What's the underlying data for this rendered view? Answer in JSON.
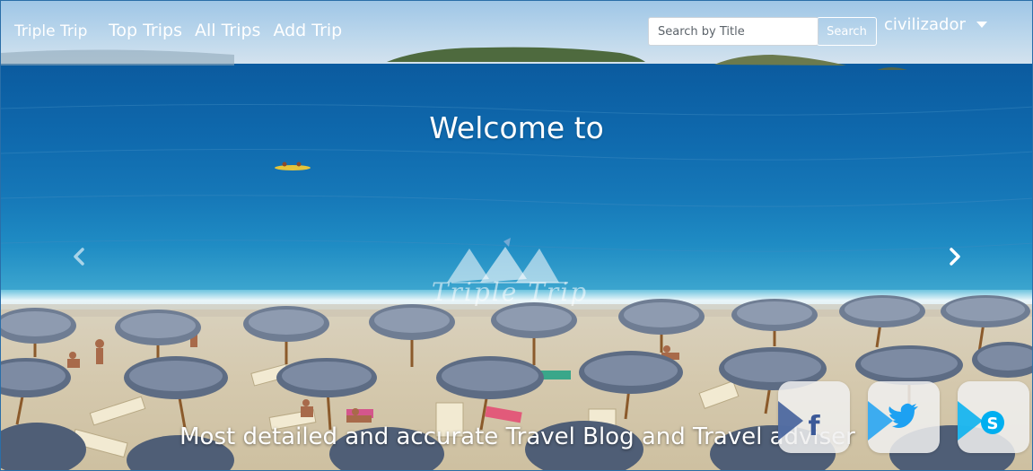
{
  "navbar": {
    "brand": "Triple Trip",
    "links": [
      "Top Trips",
      "All Trips",
      "Add Trip"
    ],
    "search": {
      "placeholder": "Search by Title",
      "value": "",
      "button_label": "Search"
    },
    "user": {
      "name": "civilizador"
    }
  },
  "carousel": {
    "title": "Welcome to",
    "logo_text": "Triple Trip",
    "caption": "Most detailed and accurate Travel Blog and Travel adviser",
    "controls": {
      "prev_icon": "chevron-left-icon",
      "next_icon": "chevron-right-icon"
    }
  },
  "social": {
    "items": [
      {
        "name": "facebook",
        "icon": "facebook-icon",
        "color": "#3b5998"
      },
      {
        "name": "twitter",
        "icon": "twitter-icon",
        "color": "#1da1f2"
      },
      {
        "name": "skype",
        "icon": "skype-icon",
        "color": "#00aff0"
      }
    ]
  }
}
